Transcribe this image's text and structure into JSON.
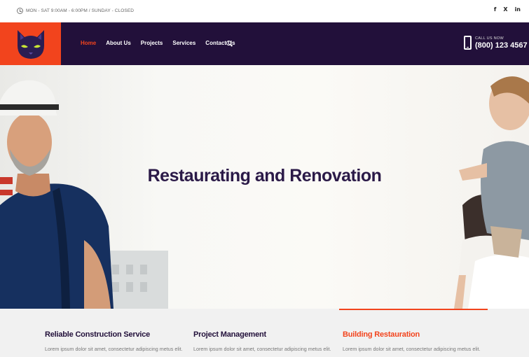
{
  "topbar": {
    "hours": "MON - SAT 9:00AM - 6:00PM / SUNDAY - CLOSED",
    "social": [
      {
        "icon": "facebook-icon",
        "glyph": "f"
      },
      {
        "icon": "x-twitter-icon",
        "glyph": "X"
      },
      {
        "icon": "linkedin-icon",
        "glyph": "in"
      }
    ]
  },
  "nav": {
    "items": [
      {
        "label": "Home",
        "active": true
      },
      {
        "label": "About Us",
        "active": false
      },
      {
        "label": "Projects",
        "active": false
      },
      {
        "label": "Services",
        "active": false
      },
      {
        "label": "Contact Us",
        "active": false
      }
    ]
  },
  "call": {
    "label": "CALL US NOW",
    "number": "(800) 123 4567"
  },
  "hero": {
    "title": "Restaurating and Renovation"
  },
  "features": [
    {
      "title": "Reliable Construction Service",
      "text": "Lorem ipsum dolor sit amet, consectetur adipiscing metus elit.",
      "active": false
    },
    {
      "title": "Project Management",
      "text": "Lorem ipsum dolor sit amet, consectetur adipiscing metus elit.",
      "active": false
    },
    {
      "title": "Building Restauration",
      "text": "Lorem ipsum dolor sit amet, consectetur adipiscing metus elit.",
      "active": true
    }
  ],
  "colors": {
    "accent": "#f2441d",
    "header_bg": "#22103a",
    "title": "#2b1a48"
  }
}
